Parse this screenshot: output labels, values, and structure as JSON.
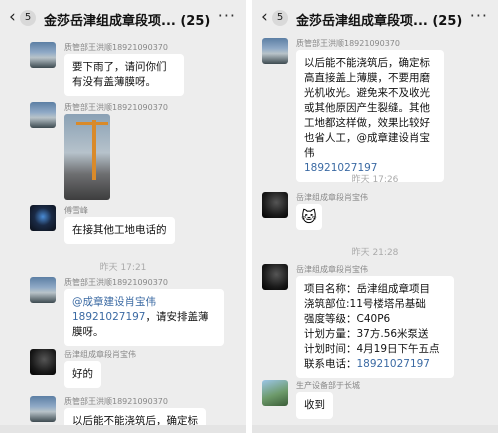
{
  "header": {
    "back_icon": "‹",
    "badge": "5",
    "title": "金莎岳津组成章段项...",
    "count": "(25)",
    "more_icon": "···"
  },
  "left_panel": {
    "messages": [
      {
        "sender": "质管部王洪顺18921090370",
        "text": "要下雨了，请问你们有没有盖薄膜呀。"
      },
      {
        "sender": "质管部王洪顺18921090370",
        "type": "image"
      },
      {
        "sender": "傅雪峰",
        "text": "在接其他工地电话的"
      },
      {
        "time": "昨天 17:21"
      },
      {
        "sender": "质管部王洪顺18921090370",
        "text_prefix": "@成章建设肖宝伟",
        "mention_phone": "18921027197",
        "text_suffix": "，请安排盖薄膜呀。"
      },
      {
        "sender": "岳津组成章段肖宝伟",
        "text": "好的"
      },
      {
        "sender": "质管部王洪顺18921090370",
        "text": "以后能不能浇筑后，确定标"
      }
    ]
  },
  "right_panel": {
    "messages": [
      {
        "sender": "质管部王洪顺18921090370",
        "text": "以后能不能浇筑后，确定标高直接盖上薄膜，不要用磨光机收光。避免来不及收光或其他原因产生裂缝。其他工地都这样做，效果比较好也省人工，@成章建设肖宝伟",
        "mention_phone": "18921027197"
      },
      {
        "time": "昨天 17:26"
      },
      {
        "sender": "岳津组成章段肖宝伟",
        "type": "sticker"
      },
      {
        "time": "昨天 21:28"
      },
      {
        "sender": "岳津组成章段肖宝伟",
        "lines": [
          "项目名称：岳津组成章项目",
          "浇筑部位:11号楼塔吊基础",
          "强度等级：C40P6",
          "计划方量：37方.56米泵送",
          "计划时间：4月19日下午五点"
        ],
        "contact_label": "联系电话：",
        "contact_phone": "18921027197"
      },
      {
        "sender": "生产设备部于长城",
        "text": "收到"
      }
    ]
  },
  "colors": {
    "mention": "#3b6aa3",
    "chat_bg": "#ededed",
    "bubble": "#ffffff"
  }
}
